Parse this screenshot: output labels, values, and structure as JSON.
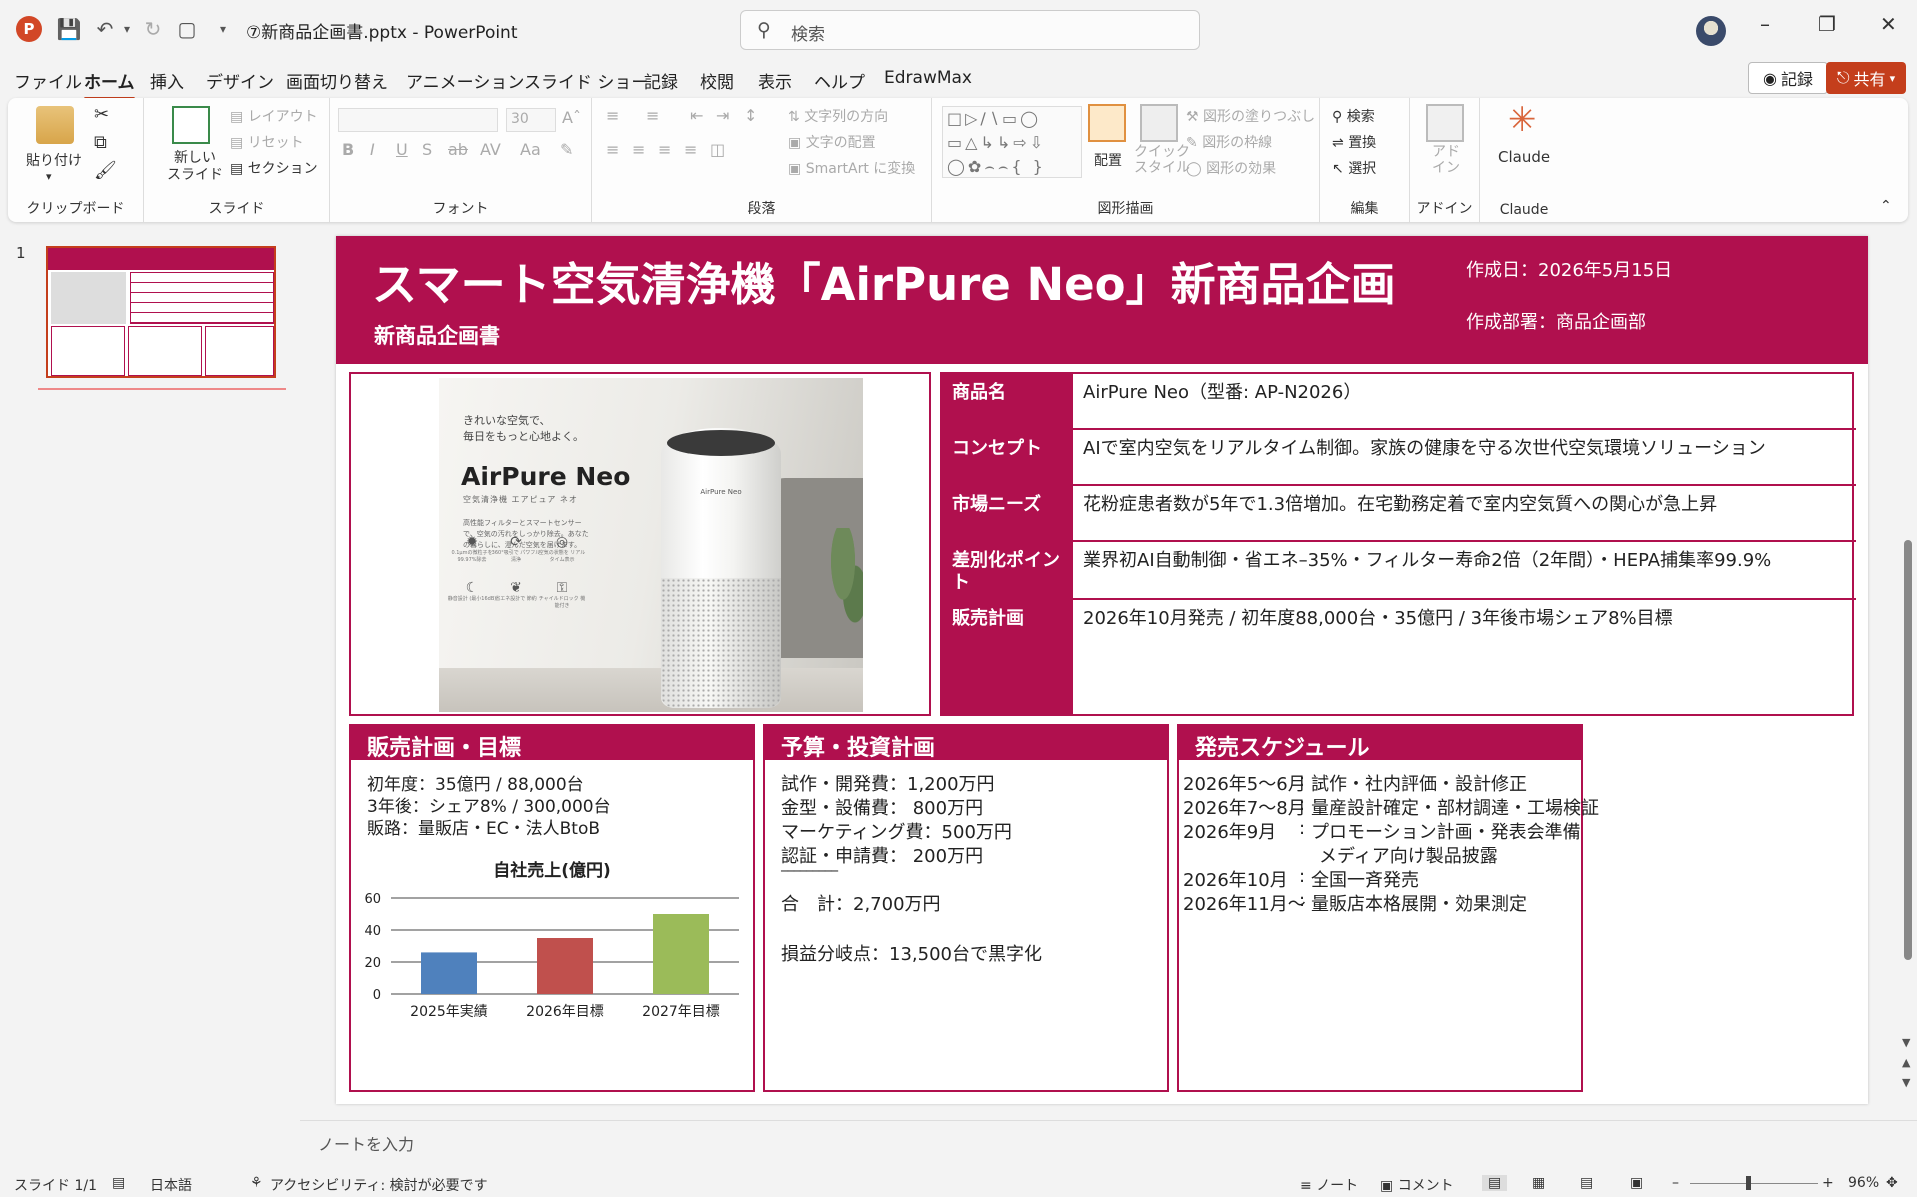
{
  "titlebar": {
    "doc_title": "⑦新商品企画書.pptx  -  PowerPoint",
    "search_placeholder": "検索",
    "app_logo": "P"
  },
  "menu": {
    "tabs": [
      "ファイル",
      "ホーム",
      "挿入",
      "デザイン",
      "画面切り替え",
      "アニメーション",
      "スライド ショー",
      "記録",
      "校閲",
      "表示",
      "ヘルプ",
      "EdrawMax"
    ],
    "active": "ホーム",
    "record_label": "記録",
    "share_label": "共有"
  },
  "ribbon": {
    "clipboard": {
      "paste": "貼り付け",
      "label": "クリップボード"
    },
    "slides": {
      "new_slide": "新しい\nスライド",
      "layout": "レイアウト",
      "reset": "リセット",
      "section": "セクション",
      "label": "スライド"
    },
    "font": {
      "size": "30",
      "label": "フォント"
    },
    "paragraph": {
      "text_direction": "文字列の方向",
      "align_text": "文字の配置",
      "smartart": "SmartArt に変換",
      "label": "段落"
    },
    "drawing": {
      "arrange": "配置",
      "quick_styles": "クイック\nスタイル",
      "fill": "図形の塗りつぶし",
      "outline": "図形の枠線",
      "effects": "図形の効果",
      "label": "図形描画"
    },
    "editing": {
      "find": "検索",
      "replace": "置換",
      "select": "選択",
      "label": "編集"
    },
    "addins": {
      "addin": "アド\nイン",
      "label": "アドイン"
    },
    "claude": {
      "label": "Claude",
      "group_label": "Claude"
    }
  },
  "thumbnails": {
    "slide_number": "1"
  },
  "slide": {
    "title": "スマート空気清浄機「AirPure Neo」新商品企画",
    "subtitle": "新商品企画書",
    "created_date": "作成日：2026年5月15日",
    "created_dept": "作成部署：商品企画部",
    "product_image": {
      "tagline1": "きれいな空気で、",
      "tagline2": "毎日をもっと心地よく。",
      "brand": "AirPure Neo",
      "kana": "空気清浄機 エアピュア ネオ",
      "desc": "高性能フィルターとスマートセンサーで、空気の汚れをしっかり除去。あなたの暮らしに、澄んだ空気を届けます。",
      "device_name": "AirPure Neo",
      "features": [
        "0.1μmの微粒子を 99.97%除去",
        "360°吸引で パワフル清浄",
        "空気の状態を リアルタイム表示",
        "静音設計 (最小16dB)",
        "省エネ設計で 節約",
        "チャイルドロック 機能付き"
      ]
    },
    "info_table": [
      {
        "key": "商品名",
        "value": "AirPure Neo（型番: AP-N2026）"
      },
      {
        "key": "コンセプト",
        "value": "AIで室内空気をリアルタイム制御。家族の健康を守る次世代空気環境ソリューション"
      },
      {
        "key": "市場ニーズ",
        "value": "花粉症患者数が5年で1.3倍増加。在宅勤務定着で室内空気質への関心が急上昇"
      },
      {
        "key": "差別化ポイント",
        "value": "業界初AI自動制御・省エネ–35%・フィルター寿命2倍（2年間）・HEPA捕集率99.9%"
      },
      {
        "key": "販売計画",
        "value": "2026年10月発売 / 初年度88,000台・35億円 / 3年後市場シェア8%目標"
      }
    ],
    "sales_box": {
      "title": "販売計画・目標",
      "lines": [
        "初年度：35億円 / 88,000台",
        "3年後：シェア8% / 300,000台",
        "販路：量販店・EC・法人BtoB"
      ]
    },
    "budget_box": {
      "title": "予算・投資計画",
      "lines": [
        "試作・開発費：1,200万円",
        "金型・設備費：  800万円",
        "マーケティング費：500万円",
        "認証・申請費：  200万円"
      ],
      "divider": "─────────",
      "total": "合　計：2,700万円",
      "breakeven": "損益分岐点：13,500台で黒字化"
    },
    "schedule_box": {
      "title": "発売スケジュール",
      "items": [
        {
          "date": "2026年5〜6月",
          "task": "試作・社内評価・設計修正"
        },
        {
          "date": "2026年7〜8月",
          "task": "量産設計確定・部材調達・工場検証"
        },
        {
          "date": "2026年9月",
          "task": "プロモーション計画・発表会準備"
        },
        {
          "date": "",
          "task": "メディア向け製品披露"
        },
        {
          "date": "2026年10月",
          "task": "全国一斉発売"
        },
        {
          "date": "2026年11月〜",
          "task": "量販店本格展開・効果測定"
        }
      ]
    }
  },
  "chart_data": {
    "type": "bar",
    "title": "自社売上(億円)",
    "categories": [
      "2025年実績",
      "2026年目標",
      "2027年目標"
    ],
    "values": [
      26,
      35,
      50
    ],
    "colors": [
      "#4f81bd",
      "#c0504d",
      "#9bbb59"
    ],
    "ylim": [
      0,
      60
    ],
    "yticks": [
      "0",
      "20",
      "40",
      "60"
    ],
    "grid": true
  },
  "notes": {
    "placeholder": "ノートを入力"
  },
  "statusbar": {
    "slide_info": "スライド 1/1",
    "language": "日本語",
    "accessibility": "アクセシビリティ: 検討が必要です",
    "notes_btn": "ノート",
    "comments_btn": "コメント",
    "zoom": "96%"
  },
  "colors": {
    "accent": "#b0104e",
    "brand": "#c43e1c"
  }
}
